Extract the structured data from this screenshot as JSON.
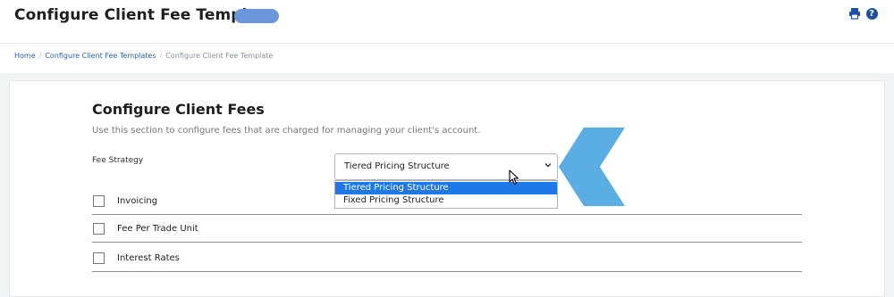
{
  "header": {
    "title": "Configure Client Fee Template"
  },
  "breadcrumb": {
    "home": "Home",
    "templates": "Configure Client Fee Templates",
    "current": "Configure Client Fee Template",
    "separator": "/"
  },
  "section": {
    "title": "Configure Client Fees",
    "description": "Use this section to configure fees that are charged for managing your client's account.",
    "fee_strategy_label": "Fee Strategy"
  },
  "fee_strategy": {
    "selected": "Tiered Pricing Structure",
    "options": [
      "Tiered Pricing Structure",
      "Fixed Pricing Structure"
    ]
  },
  "fee_rows": [
    {
      "label": "Invoicing",
      "checked": false
    },
    {
      "label": "Fee Per Trade Unit",
      "checked": false
    },
    {
      "label": "Interest Rates",
      "checked": false
    }
  ],
  "colors": {
    "accent_blue": "#1f4fa5",
    "status_pill": "#6c98db",
    "highlight": "#1e78e8",
    "annotation_arrow": "#5aaee3"
  },
  "icons": {
    "print": "print-icon",
    "help": "help-icon",
    "chevron": "chevron-down-icon",
    "cursor": "mouse-pointer-icon",
    "annotation": "chevron-left-arrow-icon"
  }
}
